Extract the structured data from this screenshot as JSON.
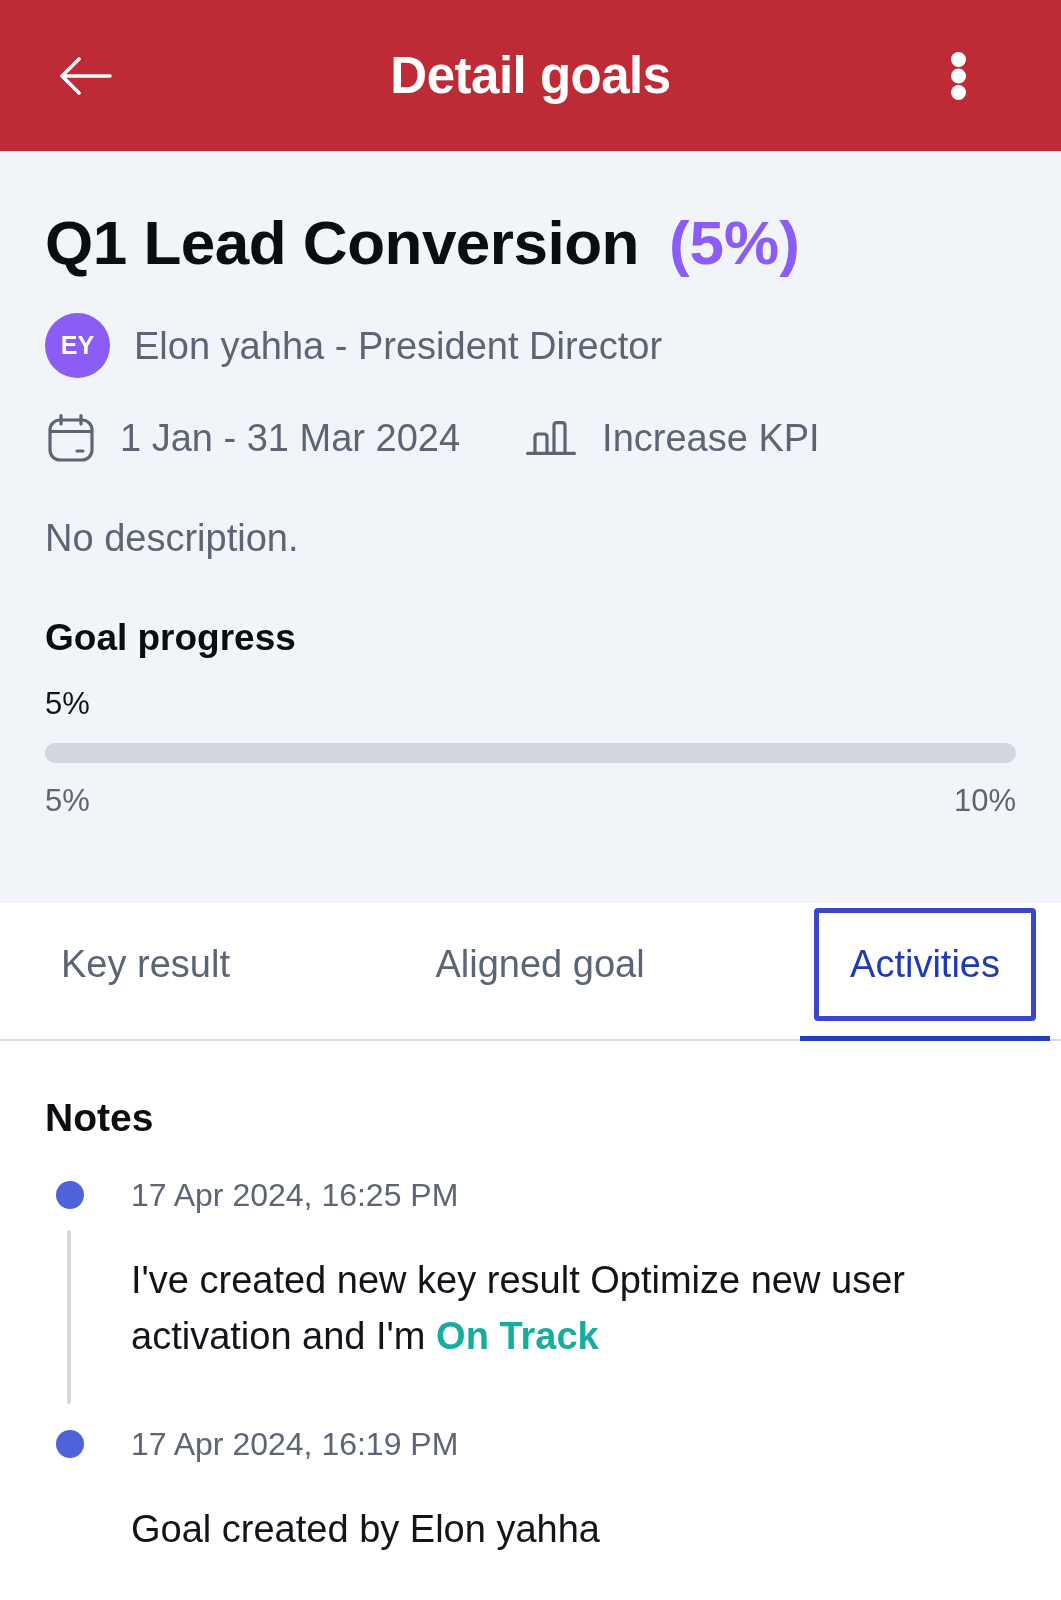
{
  "header": {
    "title": "Detail goals"
  },
  "goal": {
    "title": "Q1 Lead Conversion",
    "percent": "(5%)",
    "owner": {
      "initials": "EY",
      "label": "Elon yahha - President Director"
    },
    "period": "1 Jan - 31 Mar 2024",
    "type": "Increase KPI",
    "description": "No description."
  },
  "goal_progress": {
    "title": "Goal progress",
    "current": "5%",
    "level": 0,
    "start": "5%",
    "target": "10%"
  },
  "tabs": [
    {
      "label": "Key result",
      "selected": false
    },
    {
      "label": "Aligned goal",
      "selected": false
    },
    {
      "label": "Activities",
      "selected": true
    }
  ],
  "notes": {
    "title": "Notes",
    "items": [
      {
        "time": "17 Apr 2024, 16:25 PM",
        "text": "I've created new key result Optimize new user activation and I'm **On Track**"
      },
      {
        "time": "17 Apr 2024, 16:19 PM",
        "text": "Goal created by Elon yahha"
      }
    ]
  }
}
